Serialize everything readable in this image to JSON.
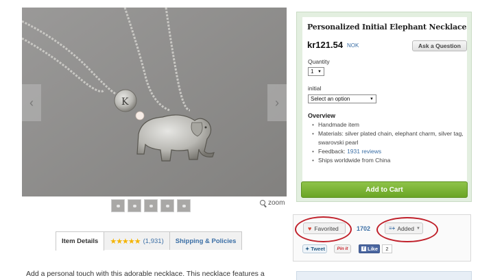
{
  "product": {
    "title": "Personalized Initial Elephant Necklace",
    "price": "kr121.54",
    "currency": "NOK",
    "ask_label": "Ask a Question",
    "quantity_label": "Quantity",
    "quantity_value": "1",
    "initial_label": "initial",
    "initial_value": "Select an option",
    "overview_title": "Overview",
    "overview": [
      "Handmade item",
      "Materials: silver plated chain, elephant charm, silver tag, swarovski pearl",
      "Ships worldwide from China"
    ],
    "feedback_label": "Feedback:",
    "feedback_reviews": "1931 reviews",
    "add_to_cart": "Add to Cart"
  },
  "social": {
    "favorited_label": "Favorited",
    "favorite_count": "1702",
    "added_label": "Added",
    "tweet_label": "Tweet",
    "pin_label": "Pin it",
    "like_label": "Like",
    "like_count": "2"
  },
  "tabs": {
    "item_details": "Item Details",
    "stars": "★★★★★",
    "review_count": "(1,931)",
    "shipping": "Shipping & Policies"
  },
  "zoom_label": "zoom",
  "description": "Add a personal touch with this adorable necklace. This necklace features a",
  "colors": {
    "accent_green": "#6aa524",
    "link_blue": "#3a6ea5",
    "annotation_red": "#c0202a"
  }
}
